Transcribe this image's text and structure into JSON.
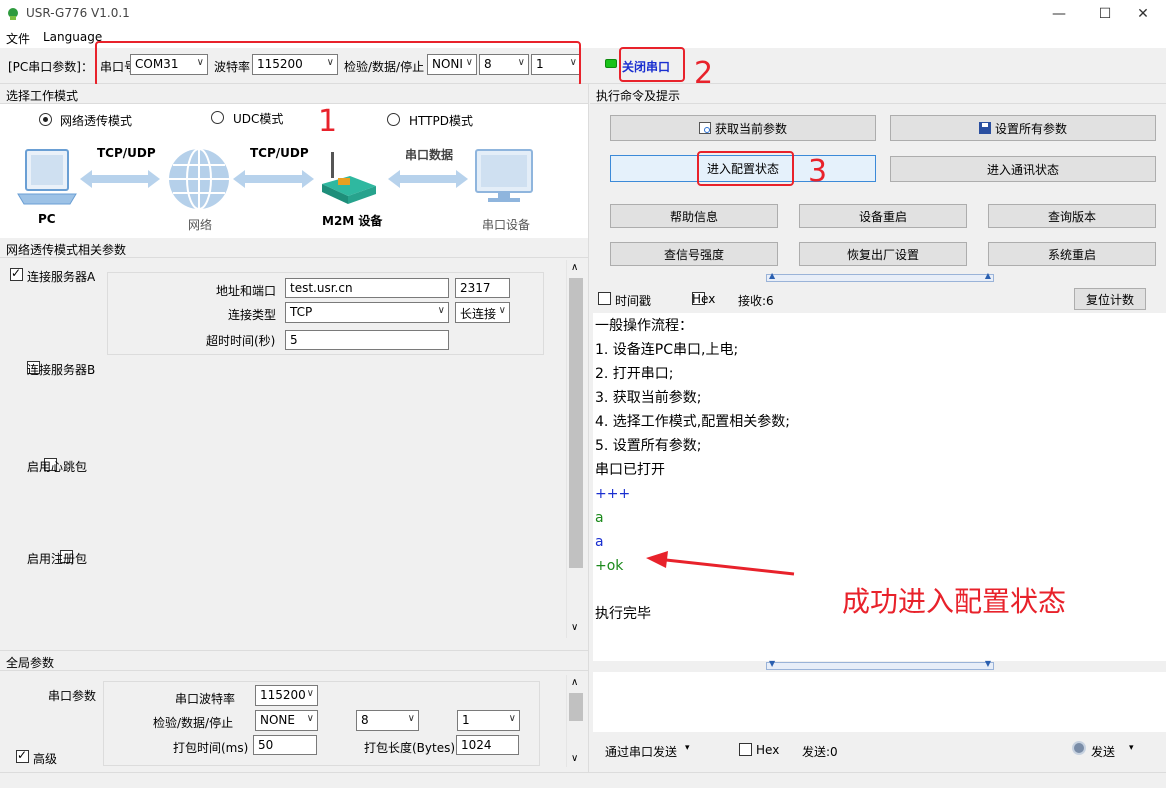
{
  "window": {
    "title": "USR-G776 V1.0.1",
    "minimize": "—",
    "maximize": "☐",
    "close": "✕"
  },
  "menu": [
    "文件",
    "Language"
  ],
  "serial": {
    "group_label": "[PC串口参数]：",
    "port_label": "串口号",
    "port_value": "COM31",
    "baud_label": "波特率",
    "baud_value": "115200",
    "parity_label": "检验/数据/停止",
    "parity_value": "NONI",
    "data_value": "8",
    "stop_value": "1",
    "open_button": "关闭串口",
    "status_color": "#19c219"
  },
  "annotations": {
    "n1": "1",
    "n2": "2",
    "n3": "3",
    "success_note": "成功进入配置状态",
    "accent": "#e8222b"
  },
  "work_mode": {
    "header": "选择工作模式",
    "modes": [
      "网络透传模式",
      "UDC模式",
      "HTTPD模式"
    ],
    "selected": 0,
    "diagram": {
      "pc": "PC",
      "link1": "TCP/UDP",
      "net": "网络",
      "link2": "TCP/UDP",
      "m2m": "M2M 设备",
      "link3": "串口数据",
      "serial_dev": "串口设备"
    }
  },
  "net_params": {
    "header": "网络透传模式相关参数",
    "server_a": {
      "label": "连接服务器A",
      "checked": true,
      "addr_label": "地址和端口",
      "addr": "test.usr.cn",
      "port": "2317",
      "type_label": "连接类型",
      "type": "TCP",
      "conn": "长连接",
      "timeout_label": "超时时间(秒)",
      "timeout": "5"
    },
    "server_b": {
      "label": "连接服务器B",
      "checked": false
    },
    "heartbeat": {
      "label": "启用心跳包",
      "checked": false
    },
    "register": {
      "label": "启用注册包",
      "checked": false
    }
  },
  "global": {
    "header": "全局参数",
    "serial_label": "串口参数",
    "baud_label": "串口波特率",
    "baud": "115200",
    "parity_label": "检验/数据/停止",
    "parity": "NONE",
    "data": "8",
    "stop": "1",
    "pack_time_label": "打包时间(ms)",
    "pack_time": "50",
    "pack_len_label": "打包长度(Bytes)",
    "pack_len": "1024",
    "advanced_label": "高级",
    "advanced_checked": true
  },
  "commands": {
    "header": "执行命令及提示",
    "get_params": "获取当前参数",
    "set_params": "设置所有参数",
    "enter_config": "进入配置状态",
    "enter_comm": "进入通讯状态",
    "help": "帮助信息",
    "reboot": "设备重启",
    "version": "查询版本",
    "signal": "查信号强度",
    "factory": "恢复出厂设置",
    "sys_reboot": "系统重启"
  },
  "log": {
    "timestamp_label": "时间戳",
    "hex_label": "Hex",
    "recv_label": "接收:6",
    "reset_button": "复位计数",
    "lines": [
      {
        "text": "一般操作流程：",
        "color": "#000000"
      },
      {
        "text": "1. 设备连PC串口,上电;",
        "color": "#000000"
      },
      {
        "text": "2. 打开串口;",
        "color": "#000000"
      },
      {
        "text": "3. 获取当前参数;",
        "color": "#000000"
      },
      {
        "text": "4. 选择工作模式,配置相关参数;",
        "color": "#000000"
      },
      {
        "text": "5. 设置所有参数;",
        "color": "#000000"
      },
      {
        "text": "串口已打开",
        "color": "#000000"
      },
      {
        "text": "+++",
        "color": "#1a2fd0"
      },
      {
        "text": "a",
        "color": "#1b8a1b"
      },
      {
        "text": "a",
        "color": "#1a2fd0"
      },
      {
        "text": "+ok",
        "color": "#1b8a1b"
      },
      {
        "text": "",
        "color": "#000000"
      },
      {
        "text": "执行完毕",
        "color": "#000000"
      }
    ]
  },
  "send": {
    "via_label": "通过串口发送",
    "hex_label": "Hex",
    "sent_label": "发送:0",
    "send_button": "发送"
  }
}
